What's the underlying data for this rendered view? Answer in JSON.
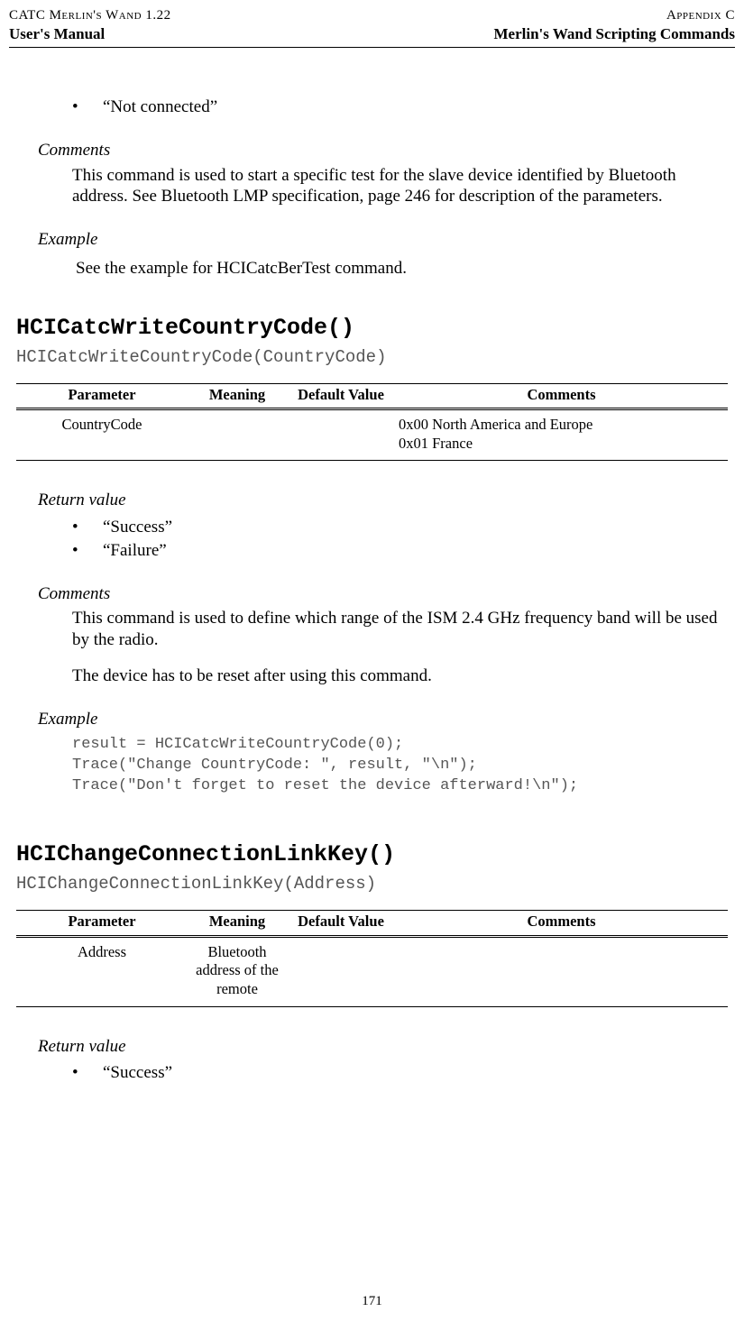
{
  "header": {
    "top_left": "CATC Merlin's Wand 1.22",
    "top_right": "Appendix C",
    "sub_left": "User's Manual",
    "sub_right": "Merlin's Wand Scripting Commands"
  },
  "s1": {
    "bullet1": "“Not connected”",
    "comments_head": "Comments",
    "comments_text": "This command is used to start a specific test for the slave device identified by Bluetooth address. See Bluetooth LMP specification, page 246 for description of the parameters.",
    "example_head": "Example",
    "example_text": "See the example for HCICatcBerTest command."
  },
  "s2": {
    "title": "HCICatcWriteCountryCode()",
    "sig": "HCICatcWriteCountryCode(CountryCode)",
    "th": {
      "p": "Parameter",
      "m": "Meaning",
      "d": "Default Value",
      "c": "Comments"
    },
    "row": {
      "param": "CountryCode",
      "meaning": "",
      "def": "",
      "comments_l1": "0x00 North America and Europe",
      "comments_l2": "0x01 France"
    },
    "rv_head": "Return value",
    "rv1": "“Success”",
    "rv2": "“Failure”",
    "comments_head": "Comments",
    "comments_p1": "This command is used to define which range of the ISM 2.4 GHz fre­quency band will be used by the radio.",
    "comments_p2": "The device has to be reset after using this command.",
    "example_head": "Example",
    "code": "result = HCICatcWriteCountryCode(0);\nTrace(\"Change CountryCode: \", result, \"\\n\");\nTrace(\"Don't forget to reset the device afterward!\\n\");"
  },
  "s3": {
    "title": "HCIChangeConnectionLinkKey()",
    "sig": "HCIChangeConnectionLinkKey(Address)",
    "th": {
      "p": "Parameter",
      "m": "Meaning",
      "d": "Default Value",
      "c": "Comments"
    },
    "row": {
      "param": "Address",
      "meaning": "Bluetooth address of the remote",
      "def": "",
      "comments": ""
    },
    "rv_head": "Return value",
    "rv1": "“Success”"
  },
  "page_number": "171"
}
